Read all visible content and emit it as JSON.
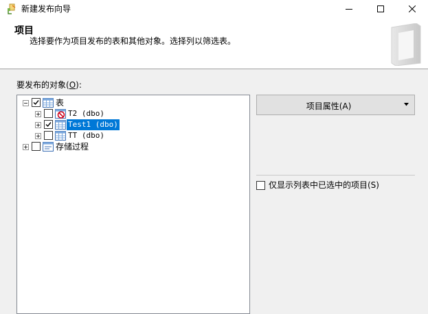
{
  "window": {
    "title": "新建发布向导",
    "icon": "publication-wizard-icon",
    "controls": [
      "minimize-icon",
      "maximize-icon",
      "close-icon"
    ]
  },
  "header": {
    "title": "项目",
    "subtitle": "选择要作为项目发布的表和其他对象。选择列以筛选表。"
  },
  "objects": {
    "label_before": "要发布的对象(",
    "label_mnemonic": "O",
    "label_after": "):",
    "tree": [
      {
        "label": "表",
        "checked": true,
        "expanded": true,
        "icon": "table-folder-icon",
        "children": [
          {
            "label": "T2 (dbo)",
            "checked": false,
            "icon": "table-no-publish-icon"
          },
          {
            "label": "Test1 (dbo)",
            "checked": true,
            "selected": true,
            "icon": "table-icon"
          },
          {
            "label": "TT (dbo)",
            "checked": false,
            "icon": "table-icon"
          }
        ]
      },
      {
        "label": "存储过程",
        "checked": false,
        "expanded": false,
        "icon": "stored-procedure-folder-icon"
      }
    ]
  },
  "item_properties": {
    "label": "项目属性(A)",
    "icon": "dropdown-arrow-icon"
  },
  "show_only_checked": {
    "label": "仅显示列表中已选中的项目(S)",
    "checked": false
  },
  "colors": {
    "selection": "#0078d7",
    "window_bg": "#f0f0f0",
    "header_bg": "#ffffff"
  }
}
